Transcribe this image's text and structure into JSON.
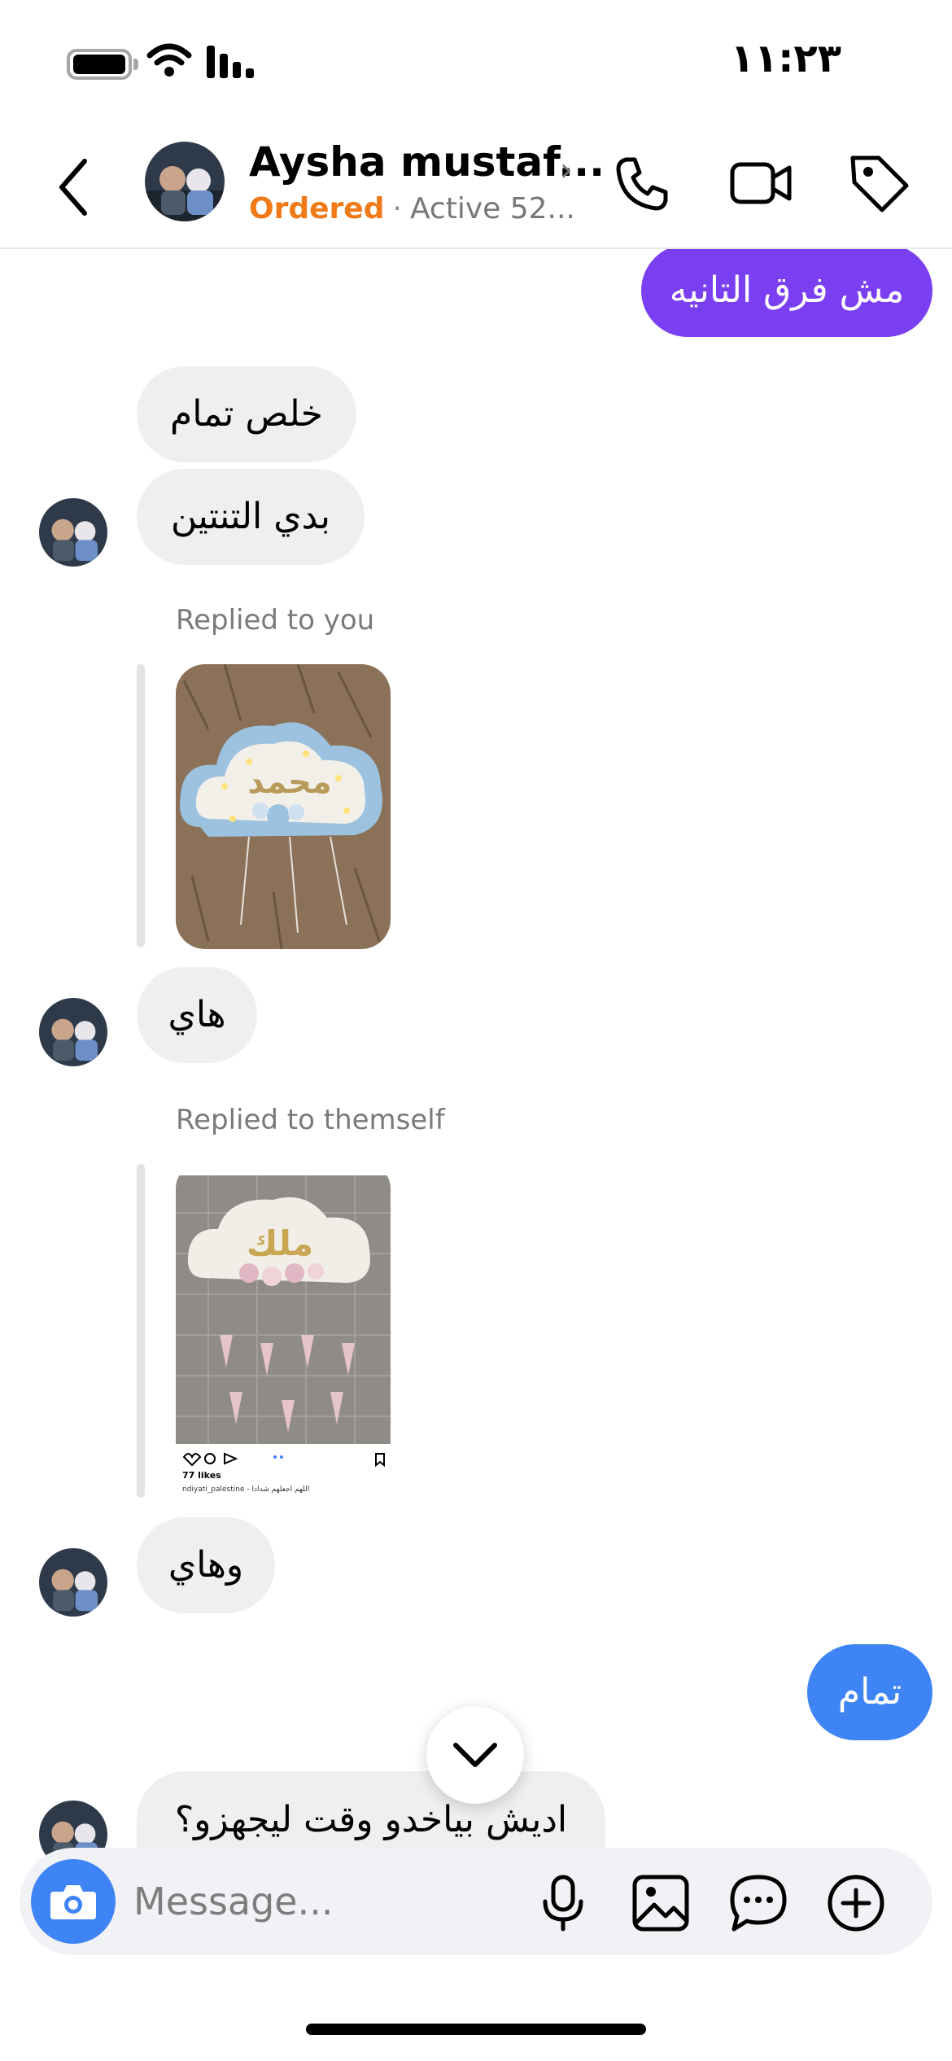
{
  "status_bar": {
    "time": "١١:٢٣",
    "icons": [
      "battery-icon",
      "wifi-icon",
      "signal-icon"
    ]
  },
  "header": {
    "name": "Aysha mustaf...",
    "order_status": "Ordered",
    "separator": "·",
    "active": "Active 52...",
    "icons": [
      "back-arrow-icon",
      "chevron-right-icon",
      "phone-icon",
      "video-camera-icon",
      "tag-icon"
    ]
  },
  "messages": [
    {
      "text": "مش فرق التانيه",
      "direction": "outgoing"
    },
    {
      "text": "خلص تمام",
      "direction": "incoming"
    },
    {
      "text": "بدي التنتين",
      "direction": "incoming"
    },
    {
      "reply_label": "Replied to you",
      "attachment": "photo",
      "thumb_text": "محمد"
    },
    {
      "text": "هاي",
      "direction": "incoming"
    },
    {
      "reply_label": "Replied to themself",
      "attachment": "post",
      "thumb_text": "ملك",
      "post_likes": "77 likes",
      "post_caption": "ndiyati_palestine - اللهم اجعلهم شدادا"
    },
    {
      "text": "وهاي",
      "direction": "incoming"
    },
    {
      "text": "تمام",
      "direction": "outgoing"
    },
    {
      "text": "اديش بياخدو وقت ليجهزو؟",
      "direction": "incoming"
    }
  ],
  "composer": {
    "placeholder": "Message...",
    "icons": [
      "camera-icon",
      "microphone-icon",
      "image-icon",
      "sticker-chat-icon",
      "plus-icon"
    ]
  },
  "colors": {
    "outgoing_purple": "#7b3ff2",
    "outgoing_blue": "#3f84f5",
    "incoming": "#efefef",
    "ordered": "#f07a17"
  }
}
